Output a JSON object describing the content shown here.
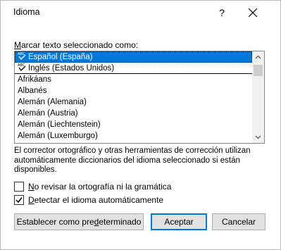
{
  "window": {
    "title": "Idioma",
    "help_glyph": "?"
  },
  "mark_label": {
    "prefix": "",
    "accel": "M",
    "rest": "arcar texto seleccionado como:"
  },
  "languages": [
    {
      "name": "Español (España)",
      "selected": true,
      "spell_icon": true
    },
    {
      "name": "Inglés (Estados Unidos)",
      "selected": false,
      "spell_icon": true
    },
    {
      "name": "Afrikáans",
      "selected": false,
      "spell_icon": false
    },
    {
      "name": "Albanés",
      "selected": false,
      "spell_icon": false
    },
    {
      "name": "Alemán (Alemania)",
      "selected": false,
      "spell_icon": false
    },
    {
      "name": "Alemán (Austria)",
      "selected": false,
      "spell_icon": false
    },
    {
      "name": "Alemán (Liechtenstein)",
      "selected": false,
      "spell_icon": false
    },
    {
      "name": "Alemán (Luxemburgo)",
      "selected": false,
      "spell_icon": false
    }
  ],
  "note": "El corrector ortográfico y otras herramientas de corrección utilizan automáticamente diccionarios del idioma seleccionado si están disponibles.",
  "options": {
    "no_spellcheck": {
      "accel": "N",
      "rest": "o revisar la ortografía ni la gramática",
      "checked": false
    },
    "detect_language": {
      "accel": "D",
      "rest": "etectar el idioma automáticamente",
      "checked": true
    }
  },
  "buttons": {
    "set_default": {
      "before": "Establecer como pre",
      "accel": "d",
      "after": "eterminado"
    },
    "ok": "Aceptar",
    "cancel": "Cancelar"
  },
  "colors": {
    "selection": "#0078d7",
    "button_bg": "#e1e1e1"
  }
}
